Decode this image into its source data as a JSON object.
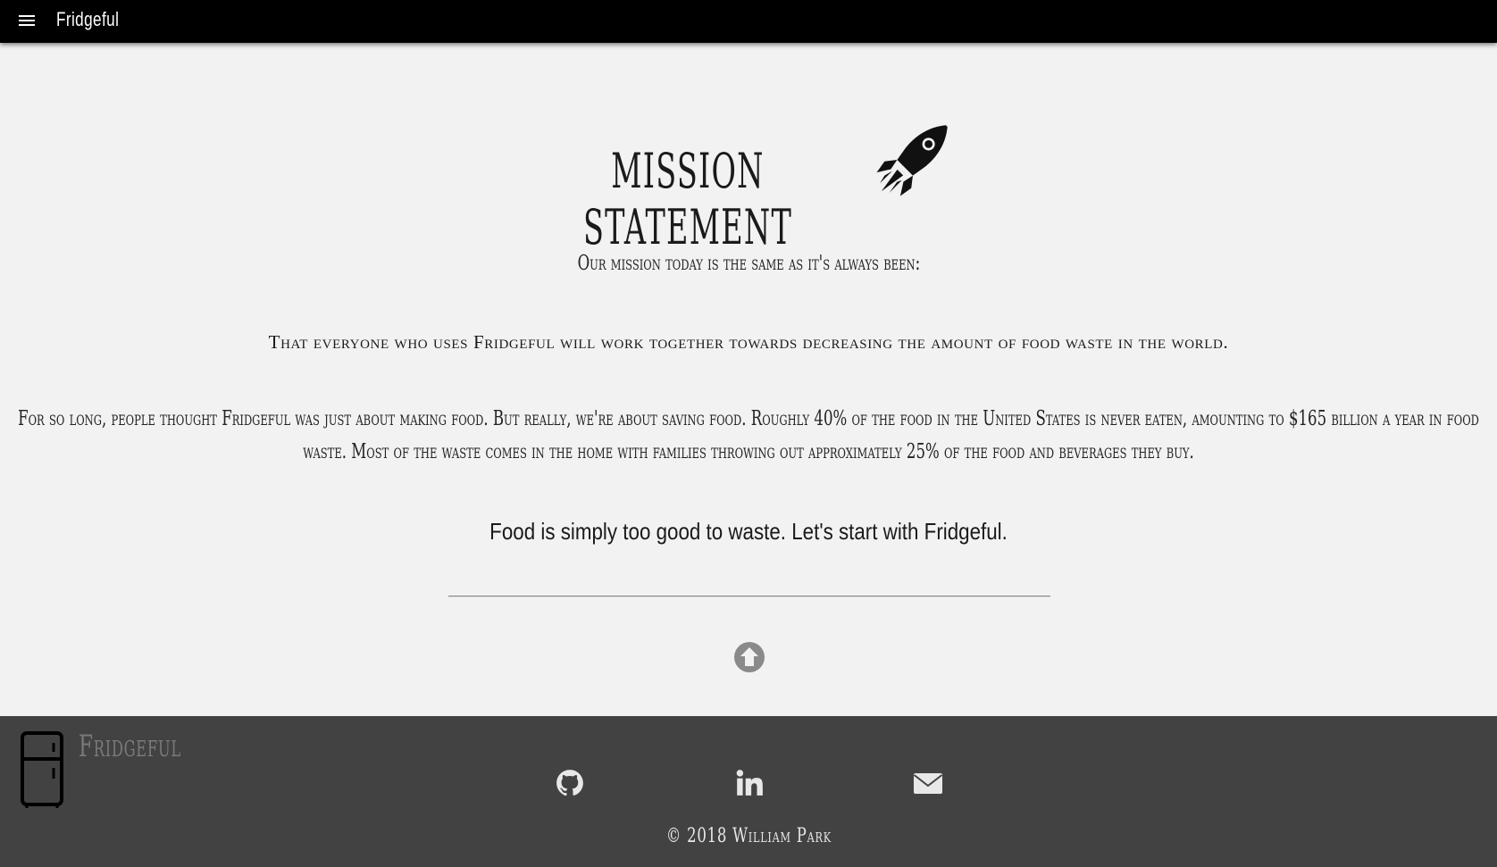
{
  "nav": {
    "menu_icon": "hamburger-menu-icon",
    "brand": "Fridgeful"
  },
  "main": {
    "title": "MISSION STATEMENT",
    "title_icon": "rocket-icon",
    "intro": "Our mission today is the same as it's always been:",
    "mission": "That everyone who uses Fridgeful will work together towards decreasing the amount of food waste in the world.",
    "paragraph": "For so long, people thought Fridgeful was just about making food. But really, we're about saving food. Roughly 40% of the food in the United States is never eaten, amounting to $165 billion a year in food waste. Most of the waste comes in the home with families throwing out approximately 25% of the food and beverages they buy.",
    "tagline": "Food is simply too good to waste. Let's start with Fridgeful.",
    "scroll_up_icon": "arrow-circle-up-icon"
  },
  "footer": {
    "logo_icon": "fridge-icon",
    "brand": "Fridgeful",
    "social": [
      {
        "name": "github-icon"
      },
      {
        "name": "linkedin-icon"
      },
      {
        "name": "envelope-icon"
      }
    ],
    "copyright": "© 2018 William Park"
  },
  "colors": {
    "nav_bg": "#000000",
    "page_bg": "#f2f2f2",
    "footer_bg": "#424242",
    "icon_gray": "#7a7a7a"
  }
}
